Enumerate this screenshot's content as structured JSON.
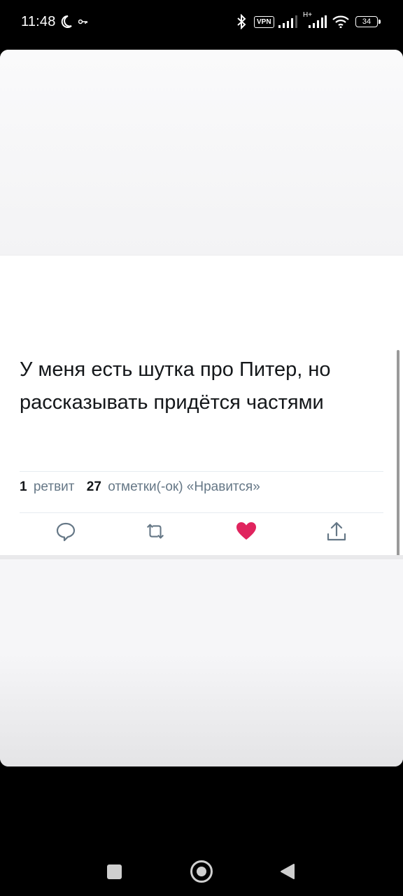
{
  "status_bar": {
    "time": "11:48",
    "vpn": "VPN",
    "network": "H+",
    "battery": "34"
  },
  "tweet": {
    "text": "У меня есть шутка про Питер, но рассказывать придётся частями",
    "retweet_count": "1",
    "retweet_label": "ретвит",
    "likes_count": "27",
    "likes_label": "отметки(-ок) «Нравится»"
  },
  "actions": {
    "reply_icon": "reply-icon",
    "retweet_icon": "retweet-icon",
    "like_icon": "heart-icon",
    "share_icon": "share-icon",
    "like_color": "#e0245e",
    "icon_color": "#657786"
  },
  "nav": {
    "recents_icon": "square-icon",
    "home_icon": "circle-icon",
    "back_icon": "triangle-back-icon"
  }
}
